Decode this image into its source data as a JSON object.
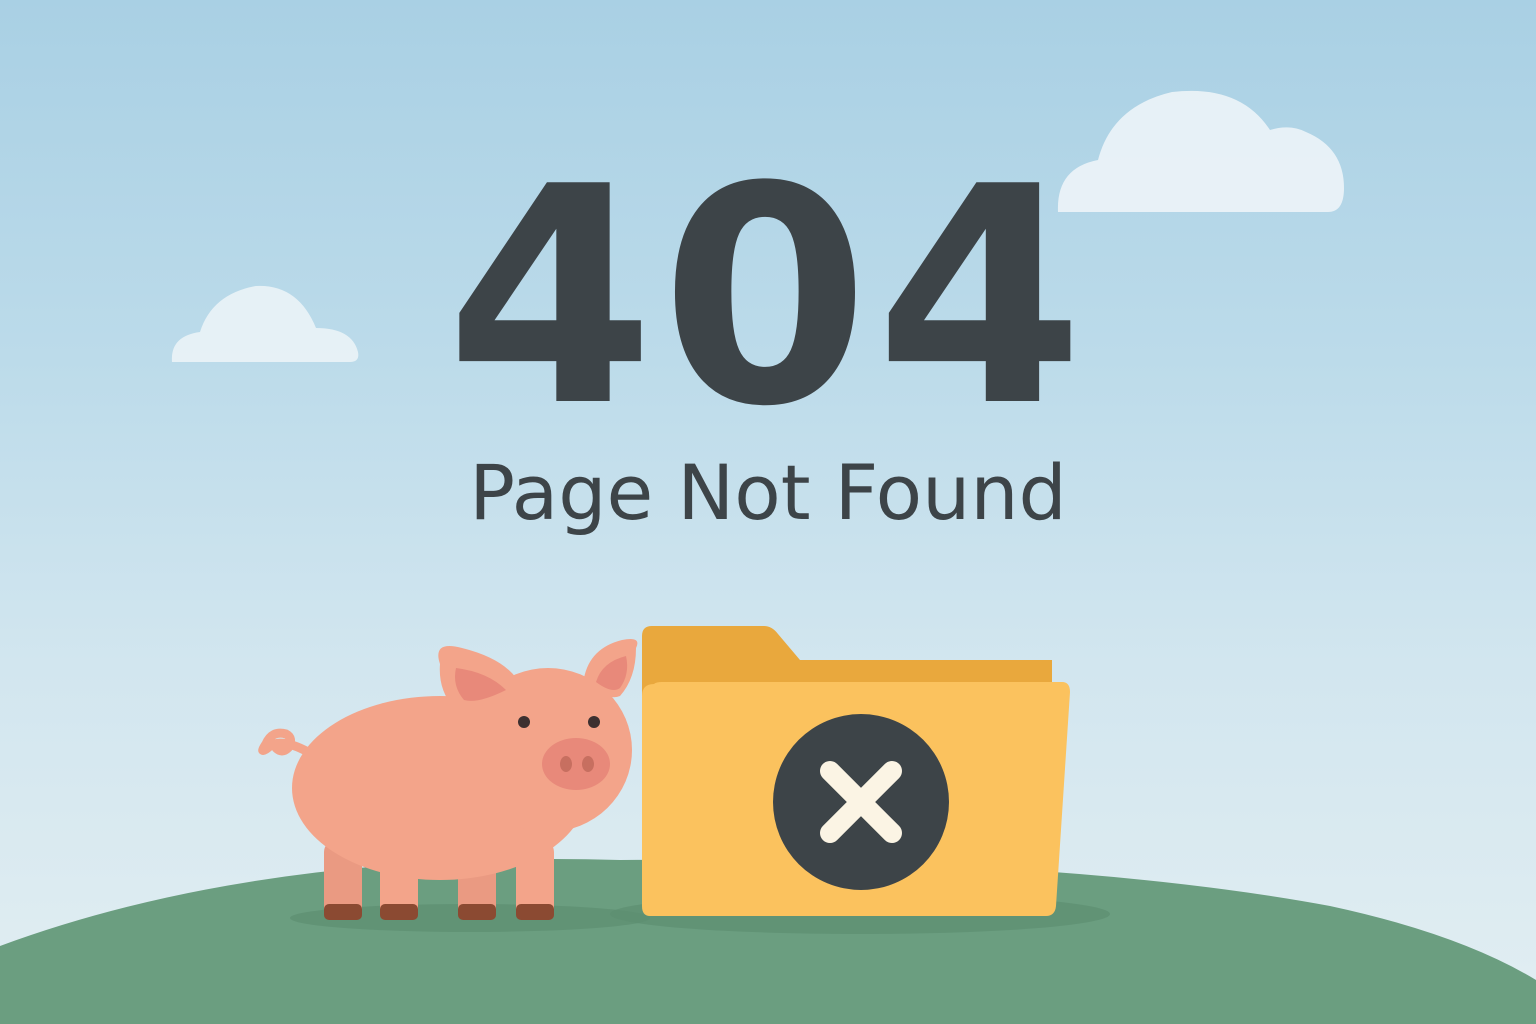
{
  "error": {
    "code": "404",
    "message": "Page Not Found"
  },
  "illustration": {
    "characters": [
      "pig"
    ],
    "icons": [
      "folder-icon",
      "error-x-icon",
      "cloud-icon"
    ]
  },
  "colors": {
    "sky_top": "#a9d0e4",
    "sky_bottom": "#e2eef2",
    "text": "#3d4448",
    "hill": "#6b9e80",
    "pig_body": "#f3a48a",
    "pig_snout": "#e8897a",
    "pig_hoof": "#8b4a32",
    "folder_back": "#e9a83d",
    "folder_front": "#fbc25e",
    "error_circle": "#3d4448",
    "error_x": "#fbf4e4",
    "cloud": "#f4f8fa"
  }
}
